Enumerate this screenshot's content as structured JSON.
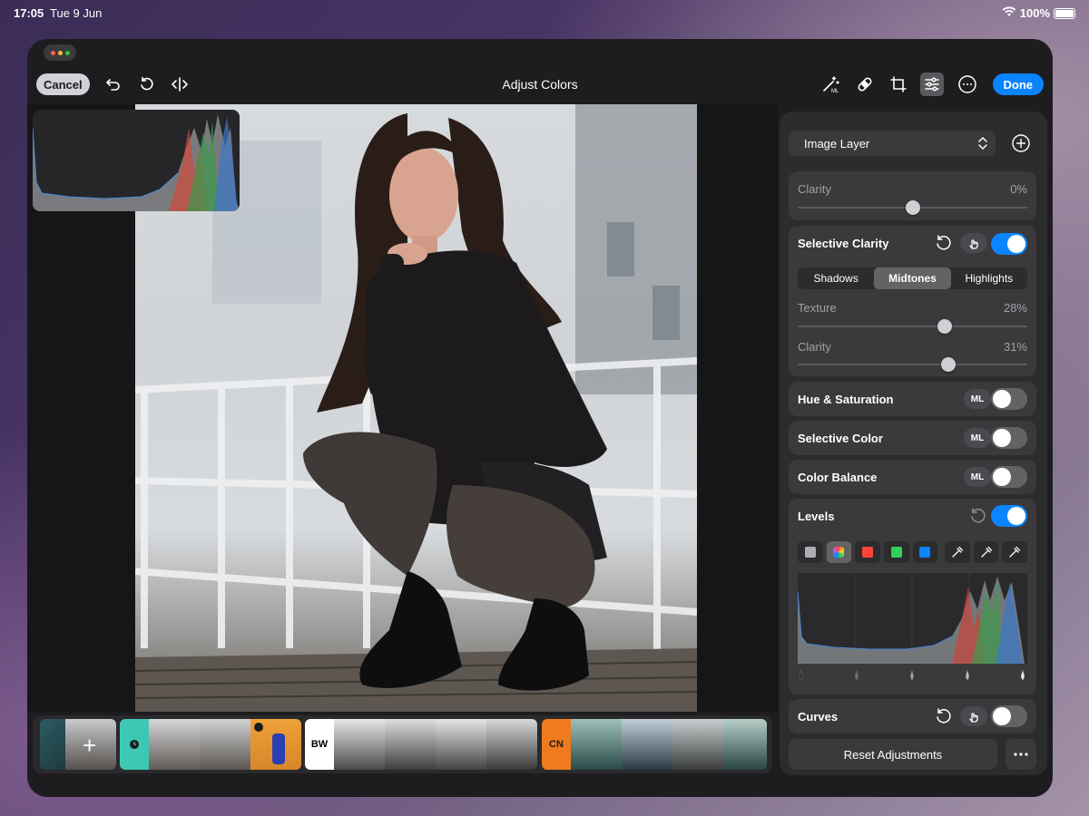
{
  "status": {
    "time": "17:05",
    "date": "Tue 9 Jun",
    "battery": "100%"
  },
  "toolbar": {
    "cancel_label": "Cancel",
    "title": "Adjust Colors",
    "done_label": "Done",
    "icons": [
      "undo-icon",
      "reset-icon",
      "compare-icon",
      "magic-wand-ml-icon",
      "healing-bandage-icon",
      "crop-icon",
      "adjust-sliders-icon",
      "more-icon"
    ]
  },
  "filmstrip": {
    "groups": [
      {
        "tag": "",
        "count": 2
      },
      {
        "tag": "",
        "count": 3
      },
      {
        "tag": "BW",
        "count": 4
      },
      {
        "tag": "CN",
        "count": 4
      }
    ]
  },
  "panel": {
    "layer": {
      "label": "Image Layer"
    },
    "clarity": {
      "label": "Clarity",
      "value": "0%",
      "level": 0.5
    },
    "selective_clarity": {
      "title": "Selective Clarity",
      "enabled": true,
      "tabs": [
        "Shadows",
        "Midtones",
        "Highlights"
      ],
      "active_tab": "Midtones",
      "texture": {
        "label": "Texture",
        "value": "28%",
        "level": 0.64
      },
      "clarity": {
        "label": "Clarity",
        "value": "31%",
        "level": 0.655
      }
    },
    "hue_saturation": {
      "title": "Hue & Saturation",
      "badge": "ML",
      "enabled": false
    },
    "selective_color": {
      "title": "Selective Color",
      "badge": "ML",
      "enabled": false
    },
    "color_balance": {
      "title": "Color Balance",
      "badge": "ML",
      "enabled": false
    },
    "levels": {
      "title": "Levels",
      "enabled": true,
      "channels": [
        "gray",
        "rgb",
        "red",
        "green",
        "blue"
      ],
      "active_channel": "rgb",
      "colors": {
        "red": "#ff453a",
        "green": "#30d158",
        "blue": "#0a84ff"
      }
    },
    "curves": {
      "title": "Curves",
      "enabled": false
    },
    "reset_label": "Reset Adjustments"
  },
  "colors": {
    "accent": "#0a84ff",
    "panel": "#2c2c2e",
    "card": "#3a3a3c"
  }
}
